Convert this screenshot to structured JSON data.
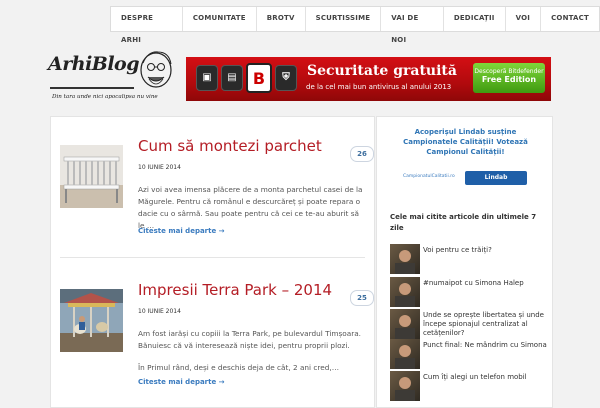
{
  "nav": {
    "items": [
      "DESPRE ARHI",
      "COMUNITATE",
      "BROTV",
      "SCURTISSIME",
      "VAI DE NOI",
      "DEDICAȚII",
      "VOI",
      "CONTACT"
    ]
  },
  "logo": {
    "title": "ArhiBlog",
    "tagline": "Din tara unde nici apocalipsa nu vine"
  },
  "banner": {
    "logo_letter": "B",
    "title": "Securitate gratuită",
    "subtitle": "de la cel mai bun antivirus al anului 2013",
    "button_line1": "Descoperă Bitdefender",
    "button_line2": "Free Edition",
    "color": "#c50d12"
  },
  "posts": [
    {
      "title": "Cum să montezi parchet",
      "date": "10 IUNIE 2014",
      "comments": "26",
      "excerpt": [
        "Azi voi avea imensa plăcere de a monta parchetul casei de la Măgurele. Pentru că românul e descurcăreț și poate repara o dacie cu o sârmă. Sau poate pentru că cei ce te-au aburit să le …"
      ],
      "readmore": "Citeste mai departe →",
      "thumb_icon": "crib-photo"
    },
    {
      "title": "Impresii Terra Park – 2014",
      "date": "10 IUNIE 2014",
      "comments": "25",
      "excerpt": [
        "Am fost iarăși cu copiii la Terra Park, pe bulevardul Timșoara. Bănuiesc că vă interesează niște idei, pentru proprii plozi.",
        "În Primul rând, deși e deschis deja de cât, 2 ani cred,…"
      ],
      "readmore": "Citeste mai departe →",
      "thumb_icon": "carousel-photo"
    }
  ],
  "sidebar": {
    "ad_text": "Acoperișul Lindab susține Campionatele Calității! Votează Campionul Calității!",
    "ad_logo1": "CampionatulCalitatii.ro",
    "ad_logo2": "Lindab",
    "popular_title": "Cele mai citite articole din ultimele 7 zile",
    "popular": [
      "Voi pentru ce trăiți?",
      "#numaipot cu Simona Halep",
      "Unde se oprește libertatea și unde începe spionajul centralizat al cetățenilor?",
      "Punct final: Ne mândrim cu Simona",
      "Cum îți alegi un telefon mobil"
    ]
  },
  "colors": {
    "post_title": "#b41d25",
    "link": "#3a7bbf",
    "comment_badge": "#3d6e9e"
  }
}
